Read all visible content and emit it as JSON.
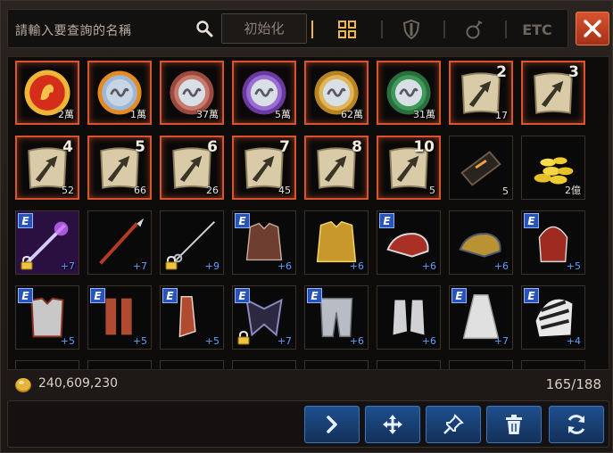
{
  "search": {
    "placeholder": "請輸入要查詢的名稱",
    "reset_label": "初始化"
  },
  "tabs": [
    {
      "id": "all",
      "icon": "grid-icon",
      "active": true
    },
    {
      "id": "armor",
      "icon": "shield-icon",
      "active": false
    },
    {
      "id": "potion",
      "icon": "potion-icon",
      "active": false
    },
    {
      "id": "etc",
      "label": "ETC",
      "active": false
    }
  ],
  "colors": {
    "highlight": "#d9542e",
    "accent": "#f0b64a",
    "action_blue": "#1f4f8e",
    "close_red": "#c2411f"
  },
  "rows": [
    [
      {
        "icon": "lion-medal-icon",
        "qty": "2萬",
        "hl": true
      },
      {
        "icon": "blue-coin-icon",
        "qty": "1萬",
        "hl": true
      },
      {
        "icon": "red-coin-icon",
        "qty": "37萬",
        "hl": true
      },
      {
        "icon": "purple-coin-icon",
        "qty": "5萬",
        "hl": true
      },
      {
        "icon": "gold-coin-icon",
        "qty": "62萬",
        "hl": true
      },
      {
        "icon": "green-coin-icon",
        "qty": "31萬",
        "hl": true
      },
      {
        "icon": "scroll-icon",
        "big": "2",
        "qty": "17",
        "hl": true
      },
      {
        "icon": "scroll-icon",
        "big": "3",
        "qty": "",
        "hl": true
      }
    ],
    [
      {
        "icon": "scroll-icon",
        "big": "4",
        "qty": "52",
        "hl": true
      },
      {
        "icon": "scroll-icon",
        "big": "5",
        "qty": "66",
        "hl": true
      },
      {
        "icon": "scroll-icon",
        "big": "6",
        "qty": "26",
        "hl": true
      },
      {
        "icon": "scroll-icon",
        "big": "7",
        "qty": "45",
        "hl": true
      },
      {
        "icon": "scroll-icon",
        "big": "8",
        "qty": "",
        "hl": true
      },
      {
        "icon": "scroll-icon",
        "big": "10",
        "qty": "5",
        "hl": true
      },
      {
        "icon": "ticket-icon",
        "qty": "5",
        "hl": false
      },
      {
        "icon": "gold-pile-icon",
        "qty": "2億",
        "hl": false
      }
    ],
    [
      {
        "icon": "magic-staff-icon",
        "qty": "+7",
        "e": true,
        "lock": true
      },
      {
        "icon": "spear-icon",
        "qty": "+7"
      },
      {
        "icon": "rapier-icon",
        "qty": "+9",
        "lock": true
      },
      {
        "icon": "leather-jacket-icon",
        "qty": "+6",
        "e": true
      },
      {
        "icon": "golden-robe-icon",
        "qty": "+6"
      },
      {
        "icon": "red-gauntlet-icon",
        "qty": "+6",
        "e": true
      },
      {
        "icon": "gold-gauntlet-icon",
        "qty": "+6"
      },
      {
        "icon": "red-helmet-icon",
        "qty": "+5",
        "e": true
      }
    ],
    [
      {
        "icon": "plate-armor-icon",
        "qty": "+5",
        "e": true
      },
      {
        "icon": "red-greaves-icon",
        "qty": "+5",
        "e": true
      },
      {
        "icon": "red-boots-icon",
        "qty": "+5",
        "e": true
      },
      {
        "icon": "dark-shoulder-icon",
        "qty": "+7",
        "e": true,
        "lock": true
      },
      {
        "icon": "silver-leggings-icon",
        "qty": "+6",
        "e": true
      },
      {
        "icon": "silver-boots-icon",
        "qty": "+6"
      },
      {
        "icon": "white-cape-icon",
        "qty": "+7",
        "e": true
      },
      {
        "icon": "striped-helm-icon",
        "qty": "+4",
        "e": true
      }
    ]
  ],
  "footer": {
    "gold": "240,609,230",
    "capacity": "165/188"
  },
  "actions": [
    {
      "name": "next-button",
      "icon": "chevron-right-icon"
    },
    {
      "name": "move-button",
      "icon": "move-arrows-icon"
    },
    {
      "name": "pin-button",
      "icon": "pin-icon"
    },
    {
      "name": "delete-button",
      "icon": "trash-icon"
    },
    {
      "name": "refresh-button",
      "icon": "refresh-icon"
    }
  ]
}
